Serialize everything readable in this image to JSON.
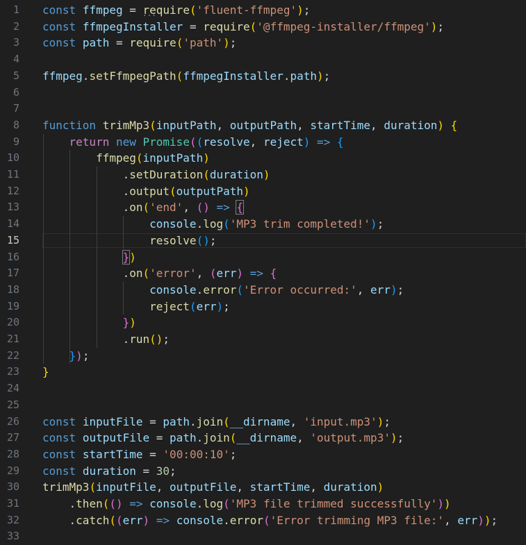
{
  "editor": {
    "language": "javascript",
    "current_line": 15,
    "lines": [
      {
        "n": "1",
        "tokens": [
          {
            "t": "const",
            "c": "kw"
          },
          {
            "t": " "
          },
          {
            "t": "ffmpeg",
            "c": "var"
          },
          {
            "t": " = ",
            "c": "op"
          },
          {
            "t": "require",
            "c": "fn"
          },
          {
            "t": "(",
            "c": "b1"
          },
          {
            "t": "'fluent-ffmpeg'",
            "c": "str"
          },
          {
            "t": ")",
            "c": "b1"
          },
          {
            "t": ";",
            "c": "op"
          }
        ]
      },
      {
        "n": "2",
        "tokens": [
          {
            "t": "const",
            "c": "kw"
          },
          {
            "t": " "
          },
          {
            "t": "ffmpegInstaller",
            "c": "var"
          },
          {
            "t": " = ",
            "c": "op"
          },
          {
            "t": "require",
            "c": "fn"
          },
          {
            "t": "(",
            "c": "b1"
          },
          {
            "t": "'@ffmpeg-installer/ffmpeg'",
            "c": "str"
          },
          {
            "t": ")",
            "c": "b1"
          },
          {
            "t": ";",
            "c": "op"
          }
        ]
      },
      {
        "n": "3",
        "tokens": [
          {
            "t": "const",
            "c": "kw"
          },
          {
            "t": " "
          },
          {
            "t": "path",
            "c": "var"
          },
          {
            "t": " = ",
            "c": "op"
          },
          {
            "t": "require",
            "c": "fn"
          },
          {
            "t": "(",
            "c": "b1"
          },
          {
            "t": "'path'",
            "c": "str"
          },
          {
            "t": ")",
            "c": "b1"
          },
          {
            "t": ";",
            "c": "op"
          }
        ]
      },
      {
        "n": "4",
        "tokens": []
      },
      {
        "n": "5",
        "tokens": [
          {
            "t": "ffmpeg",
            "c": "var"
          },
          {
            "t": ".",
            "c": "op"
          },
          {
            "t": "setFfmpegPath",
            "c": "fn"
          },
          {
            "t": "(",
            "c": "b1"
          },
          {
            "t": "ffmpegInstaller",
            "c": "var"
          },
          {
            "t": ".",
            "c": "op"
          },
          {
            "t": "path",
            "c": "var"
          },
          {
            "t": ")",
            "c": "b1"
          },
          {
            "t": ";",
            "c": "op"
          }
        ]
      },
      {
        "n": "6",
        "tokens": []
      },
      {
        "n": "7",
        "tokens": []
      },
      {
        "n": "8",
        "tokens": [
          {
            "t": "function",
            "c": "kw"
          },
          {
            "t": " "
          },
          {
            "t": "trimMp3",
            "c": "fn"
          },
          {
            "t": "(",
            "c": "b1"
          },
          {
            "t": "inputPath",
            "c": "var"
          },
          {
            "t": ", ",
            "c": "op"
          },
          {
            "t": "outputPath",
            "c": "var"
          },
          {
            "t": ", ",
            "c": "op"
          },
          {
            "t": "startTime",
            "c": "var"
          },
          {
            "t": ", ",
            "c": "op"
          },
          {
            "t": "duration",
            "c": "var"
          },
          {
            "t": ")",
            "c": "b1"
          },
          {
            "t": " "
          },
          {
            "t": "{",
            "c": "b1"
          }
        ]
      },
      {
        "n": "9",
        "tokens": [
          {
            "t": "    "
          },
          {
            "t": "return",
            "c": "ctl"
          },
          {
            "t": " "
          },
          {
            "t": "new",
            "c": "kw"
          },
          {
            "t": " "
          },
          {
            "t": "Promise",
            "c": "cls"
          },
          {
            "t": "(",
            "c": "b2"
          },
          {
            "t": "(",
            "c": "b3"
          },
          {
            "t": "resolve",
            "c": "var"
          },
          {
            "t": ", ",
            "c": "op"
          },
          {
            "t": "reject",
            "c": "var"
          },
          {
            "t": ")",
            "c": "b3"
          },
          {
            "t": " "
          },
          {
            "t": "=>",
            "c": "kw"
          },
          {
            "t": " "
          },
          {
            "t": "{",
            "c": "b3"
          }
        ]
      },
      {
        "n": "10",
        "tokens": [
          {
            "t": "        "
          },
          {
            "t": "ffmpeg",
            "c": "fn"
          },
          {
            "t": "(",
            "c": "b1"
          },
          {
            "t": "inputPath",
            "c": "var"
          },
          {
            "t": ")",
            "c": "b1"
          }
        ]
      },
      {
        "n": "11",
        "tokens": [
          {
            "t": "            "
          },
          {
            "t": ".",
            "c": "op"
          },
          {
            "t": "setDuration",
            "c": "fn"
          },
          {
            "t": "(",
            "c": "b1"
          },
          {
            "t": "duration",
            "c": "var"
          },
          {
            "t": ")",
            "c": "b1"
          }
        ]
      },
      {
        "n": "12",
        "tokens": [
          {
            "t": "            "
          },
          {
            "t": ".",
            "c": "op"
          },
          {
            "t": "output",
            "c": "fn"
          },
          {
            "t": "(",
            "c": "b1"
          },
          {
            "t": "outputPath",
            "c": "var"
          },
          {
            "t": ")",
            "c": "b1"
          }
        ]
      },
      {
        "n": "13",
        "tokens": [
          {
            "t": "            "
          },
          {
            "t": ".",
            "c": "op"
          },
          {
            "t": "on",
            "c": "fn"
          },
          {
            "t": "(",
            "c": "b1"
          },
          {
            "t": "'end'",
            "c": "str"
          },
          {
            "t": ", ",
            "c": "op"
          },
          {
            "t": "()",
            "c": "b2"
          },
          {
            "t": " "
          },
          {
            "t": "=>",
            "c": "kw"
          },
          {
            "t": " "
          },
          {
            "t": "{",
            "c": "b2",
            "bm": true
          }
        ]
      },
      {
        "n": "14",
        "tokens": [
          {
            "t": "                "
          },
          {
            "t": "console",
            "c": "var"
          },
          {
            "t": ".",
            "c": "op"
          },
          {
            "t": "log",
            "c": "fn"
          },
          {
            "t": "(",
            "c": "b3"
          },
          {
            "t": "'MP3 trim completed!'",
            "c": "str"
          },
          {
            "t": ")",
            "c": "b3"
          },
          {
            "t": ";",
            "c": "op"
          }
        ]
      },
      {
        "n": "15",
        "tokens": [
          {
            "t": "                "
          },
          {
            "t": "resolve",
            "c": "fn"
          },
          {
            "t": "()",
            "c": "b3"
          },
          {
            "t": ";",
            "c": "op"
          }
        ]
      },
      {
        "n": "16",
        "tokens": [
          {
            "t": "            "
          },
          {
            "t": "}",
            "c": "b2",
            "bm": true
          },
          {
            "t": ")",
            "c": "b1"
          }
        ]
      },
      {
        "n": "17",
        "tokens": [
          {
            "t": "            "
          },
          {
            "t": ".",
            "c": "op"
          },
          {
            "t": "on",
            "c": "fn"
          },
          {
            "t": "(",
            "c": "b1"
          },
          {
            "t": "'error'",
            "c": "str"
          },
          {
            "t": ", ",
            "c": "op"
          },
          {
            "t": "(",
            "c": "b2"
          },
          {
            "t": "err",
            "c": "var"
          },
          {
            "t": ")",
            "c": "b2"
          },
          {
            "t": " "
          },
          {
            "t": "=>",
            "c": "kw"
          },
          {
            "t": " "
          },
          {
            "t": "{",
            "c": "b2"
          }
        ]
      },
      {
        "n": "18",
        "tokens": [
          {
            "t": "                "
          },
          {
            "t": "console",
            "c": "var"
          },
          {
            "t": ".",
            "c": "op"
          },
          {
            "t": "error",
            "c": "fn"
          },
          {
            "t": "(",
            "c": "b3"
          },
          {
            "t": "'Error occurred:'",
            "c": "str"
          },
          {
            "t": ", ",
            "c": "op"
          },
          {
            "t": "err",
            "c": "var"
          },
          {
            "t": ")",
            "c": "b3"
          },
          {
            "t": ";",
            "c": "op"
          }
        ]
      },
      {
        "n": "19",
        "tokens": [
          {
            "t": "                "
          },
          {
            "t": "reject",
            "c": "fn"
          },
          {
            "t": "(",
            "c": "b3"
          },
          {
            "t": "err",
            "c": "var"
          },
          {
            "t": ")",
            "c": "b3"
          },
          {
            "t": ";",
            "c": "op"
          }
        ]
      },
      {
        "n": "20",
        "tokens": [
          {
            "t": "            "
          },
          {
            "t": "}",
            "c": "b2"
          },
          {
            "t": ")",
            "c": "b1"
          }
        ]
      },
      {
        "n": "21",
        "tokens": [
          {
            "t": "            "
          },
          {
            "t": ".",
            "c": "op"
          },
          {
            "t": "run",
            "c": "fn"
          },
          {
            "t": "()",
            "c": "b1"
          },
          {
            "t": ";",
            "c": "op"
          }
        ]
      },
      {
        "n": "22",
        "tokens": [
          {
            "t": "    "
          },
          {
            "t": "}",
            "c": "b3"
          },
          {
            "t": ")",
            "c": "b2"
          },
          {
            "t": ";",
            "c": "op"
          }
        ]
      },
      {
        "n": "23",
        "tokens": [
          {
            "t": "}",
            "c": "b1"
          }
        ]
      },
      {
        "n": "24",
        "tokens": []
      },
      {
        "n": "25",
        "tokens": []
      },
      {
        "n": "26",
        "tokens": [
          {
            "t": "const",
            "c": "kw"
          },
          {
            "t": " "
          },
          {
            "t": "inputFile",
            "c": "var"
          },
          {
            "t": " = ",
            "c": "op"
          },
          {
            "t": "path",
            "c": "var"
          },
          {
            "t": ".",
            "c": "op"
          },
          {
            "t": "join",
            "c": "fn"
          },
          {
            "t": "(",
            "c": "b1"
          },
          {
            "t": "__dirname",
            "c": "var"
          },
          {
            "t": ", ",
            "c": "op"
          },
          {
            "t": "'input.mp3'",
            "c": "str"
          },
          {
            "t": ")",
            "c": "b1"
          },
          {
            "t": ";",
            "c": "op"
          }
        ]
      },
      {
        "n": "27",
        "tokens": [
          {
            "t": "const",
            "c": "kw"
          },
          {
            "t": " "
          },
          {
            "t": "outputFile",
            "c": "var"
          },
          {
            "t": " = ",
            "c": "op"
          },
          {
            "t": "path",
            "c": "var"
          },
          {
            "t": ".",
            "c": "op"
          },
          {
            "t": "join",
            "c": "fn"
          },
          {
            "t": "(",
            "c": "b1"
          },
          {
            "t": "__dirname",
            "c": "var"
          },
          {
            "t": ", ",
            "c": "op"
          },
          {
            "t": "'output.mp3'",
            "c": "str"
          },
          {
            "t": ")",
            "c": "b1"
          },
          {
            "t": ";",
            "c": "op"
          }
        ]
      },
      {
        "n": "28",
        "tokens": [
          {
            "t": "const",
            "c": "kw"
          },
          {
            "t": " "
          },
          {
            "t": "startTime",
            "c": "var"
          },
          {
            "t": " = ",
            "c": "op"
          },
          {
            "t": "'00:00:10'",
            "c": "str"
          },
          {
            "t": ";",
            "c": "op"
          }
        ]
      },
      {
        "n": "29",
        "tokens": [
          {
            "t": "const",
            "c": "kw"
          },
          {
            "t": " "
          },
          {
            "t": "duration",
            "c": "var"
          },
          {
            "t": " = ",
            "c": "op"
          },
          {
            "t": "30",
            "c": "num"
          },
          {
            "t": ";",
            "c": "op"
          }
        ]
      },
      {
        "n": "30",
        "tokens": [
          {
            "t": "trimMp3",
            "c": "fn"
          },
          {
            "t": "(",
            "c": "b1"
          },
          {
            "t": "inputFile",
            "c": "var"
          },
          {
            "t": ", ",
            "c": "op"
          },
          {
            "t": "outputFile",
            "c": "var"
          },
          {
            "t": ", ",
            "c": "op"
          },
          {
            "t": "startTime",
            "c": "var"
          },
          {
            "t": ", ",
            "c": "op"
          },
          {
            "t": "duration",
            "c": "var"
          },
          {
            "t": ")",
            "c": "b1"
          }
        ]
      },
      {
        "n": "31",
        "tokens": [
          {
            "t": "    "
          },
          {
            "t": ".",
            "c": "op"
          },
          {
            "t": "then",
            "c": "fn"
          },
          {
            "t": "(",
            "c": "b1"
          },
          {
            "t": "()",
            "c": "b2"
          },
          {
            "t": " "
          },
          {
            "t": "=>",
            "c": "kw"
          },
          {
            "t": " "
          },
          {
            "t": "console",
            "c": "var"
          },
          {
            "t": ".",
            "c": "op"
          },
          {
            "t": "log",
            "c": "fn"
          },
          {
            "t": "(",
            "c": "b2"
          },
          {
            "t": "'MP3 file trimmed successfully'",
            "c": "str"
          },
          {
            "t": ")",
            "c": "b2"
          },
          {
            "t": ")",
            "c": "b1"
          }
        ]
      },
      {
        "n": "32",
        "tokens": [
          {
            "t": "    "
          },
          {
            "t": ".",
            "c": "op"
          },
          {
            "t": "catch",
            "c": "fn"
          },
          {
            "t": "(",
            "c": "b1"
          },
          {
            "t": "(",
            "c": "b2"
          },
          {
            "t": "err",
            "c": "var"
          },
          {
            "t": ")",
            "c": "b2"
          },
          {
            "t": " "
          },
          {
            "t": "=>",
            "c": "kw"
          },
          {
            "t": " "
          },
          {
            "t": "console",
            "c": "var"
          },
          {
            "t": ".",
            "c": "op"
          },
          {
            "t": "error",
            "c": "fn"
          },
          {
            "t": "(",
            "c": "b2"
          },
          {
            "t": "'Error trimming MP3 file:'",
            "c": "str"
          },
          {
            "t": ", ",
            "c": "op"
          },
          {
            "t": "err",
            "c": "var"
          },
          {
            "t": ")",
            "c": "b2"
          },
          {
            "t": ")",
            "c": "b1"
          },
          {
            "t": ";",
            "c": "op"
          }
        ]
      },
      {
        "n": "33",
        "tokens": []
      }
    ]
  }
}
